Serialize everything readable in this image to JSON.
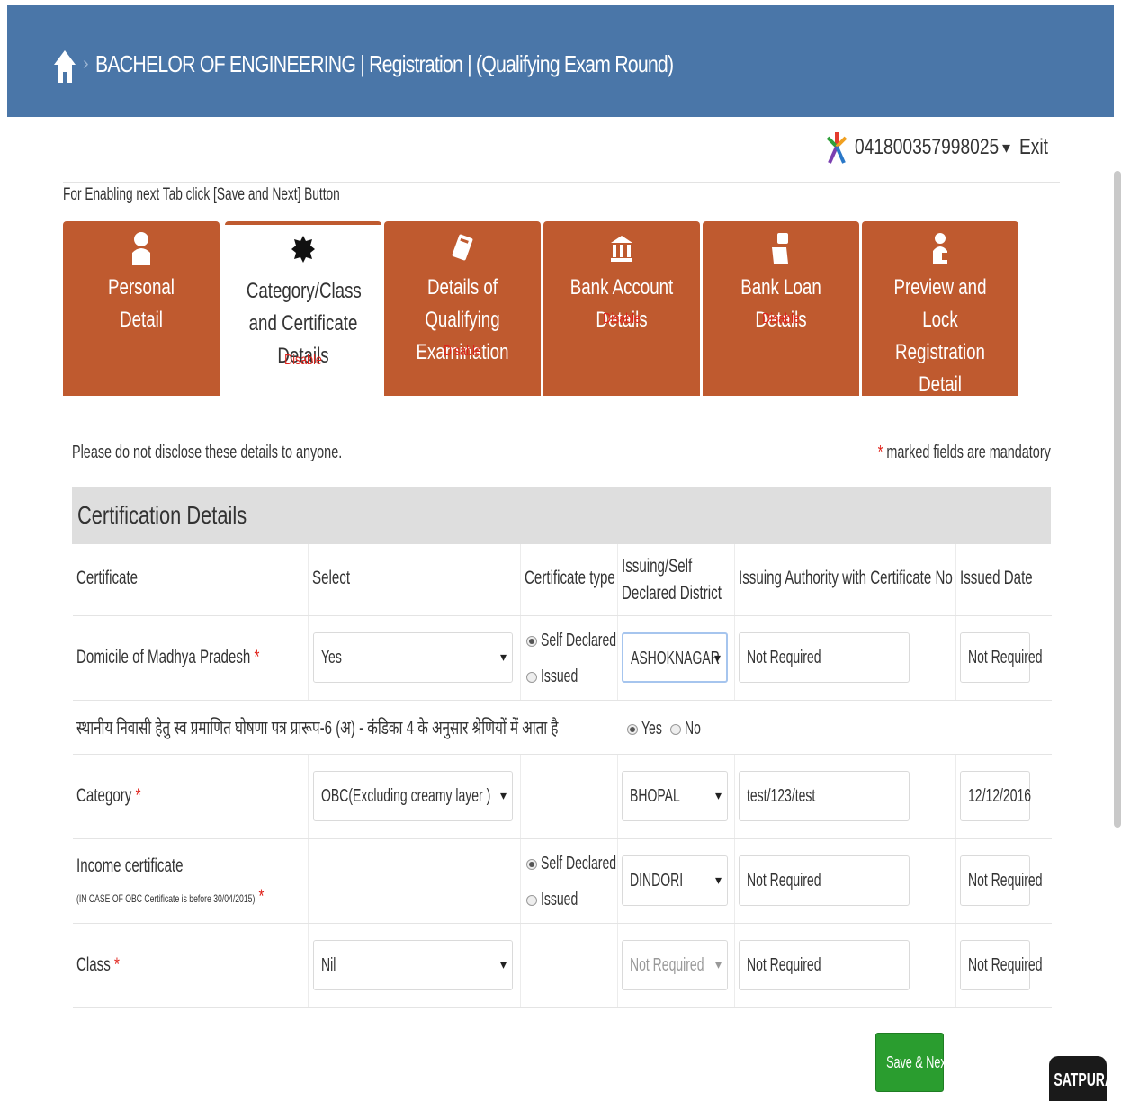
{
  "header": {
    "title": "BACHELOR OF ENGINEERING | Registration | (Qualifying Exam Round)",
    "separator": "›"
  },
  "user": {
    "id": "041800357998025",
    "caret": "▾",
    "exit_label": "Exit"
  },
  "hint": "For Enabling next Tab click [Save and Next] Button",
  "tabs": [
    {
      "label": "Personal Detail",
      "status": "",
      "icon": "user-icon"
    },
    {
      "label": "Category/Class and Certificate Details",
      "status": "Disable",
      "icon": "badge-icon"
    },
    {
      "label": "Details of Qualifying Examination",
      "status": "Disable",
      "icon": "book-icon"
    },
    {
      "label": "Bank Account Details",
      "status": "Disable",
      "icon": "bank-icon"
    },
    {
      "label": "Bank Loan Details",
      "status": "Disable",
      "icon": "loan-icon"
    },
    {
      "label": "Preview and Lock Registration Detail",
      "status": "",
      "icon": "lock-user-icon"
    }
  ],
  "notice": "Please do not disclose these details to anyone.",
  "mandatory": {
    "star": "*",
    "text": "marked fields are mandatory"
  },
  "section_title": "Certification Details",
  "columns": [
    "Certificate",
    "Select",
    "Certificate type",
    "Issuing/Self Declared District",
    "Issuing Authority with Certificate No",
    "Issued Date"
  ],
  "rows": {
    "domicile": {
      "label": "Domicile of Madhya Pradesh",
      "select": "Yes",
      "type_options": [
        "Self Declared",
        "Issued"
      ],
      "district": "ASHOKNAGAR",
      "authority": "Not Required",
      "date": "Not Required"
    },
    "declaration": {
      "text": "स्थानीय निवासी हेतु स्व प्रमाणित घोषणा पत्र प्रारूप-6 (अ) - कंडिका 4 के अनुसार श्रेणियों में आता है",
      "options": [
        "Yes",
        "No"
      ]
    },
    "category": {
      "label": "Category",
      "select": "OBC(Excluding creamy layer )",
      "district": "BHOPAL",
      "authority": "test/123/test",
      "date": "12/12/2016"
    },
    "income": {
      "label": "Income certificate",
      "sub": "(IN CASE OF OBC Certificate is before 30/04/2015)",
      "type_options": [
        "Self Declared",
        "Issued"
      ],
      "district": "DINDORI",
      "authority": "Not Required",
      "date": "Not Required"
    },
    "class": {
      "label": "Class",
      "select": "Nil",
      "district": "Not Required",
      "authority": "Not Required",
      "date": "Not Required"
    }
  },
  "save_label": "Save & Next",
  "brand": "SATPURA",
  "arrow": "▾",
  "colors": {
    "header": "#4a76a8",
    "tab": "#bf5a2f",
    "save": "#2a9d2f",
    "required": "#e0231b"
  }
}
